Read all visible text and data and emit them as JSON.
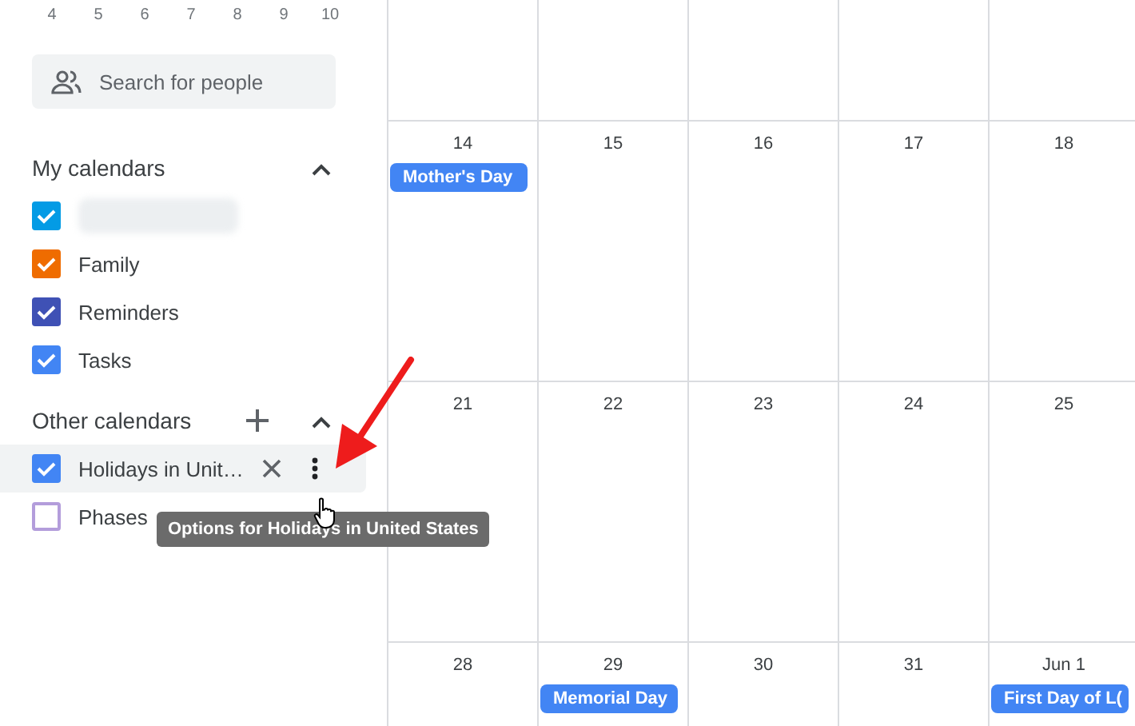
{
  "mini_calendar": {
    "days": [
      "4",
      "5",
      "6",
      "7",
      "8",
      "9",
      "10"
    ]
  },
  "search": {
    "placeholder": "Search for people"
  },
  "my_calendars": {
    "title": "My calendars",
    "expanded": true,
    "items": [
      {
        "kind": "redacted",
        "checked": true,
        "color": "#039be5"
      },
      {
        "kind": "calendar",
        "label": "Family",
        "checked": true,
        "color": "#ef6c00"
      },
      {
        "kind": "calendar",
        "label": "Reminders",
        "checked": true,
        "color": "#3f51b5"
      },
      {
        "kind": "calendar",
        "label": "Tasks",
        "checked": true,
        "color": "#4285f4"
      }
    ]
  },
  "other_calendars": {
    "title": "Other calendars",
    "expanded": true,
    "items": [
      {
        "label": "Holidays in Unit…",
        "checked": true,
        "color": "#4285f4",
        "hovered": true
      },
      {
        "label": "Phases",
        "checked": false,
        "color": "#b39ddb",
        "hovered": false
      }
    ]
  },
  "tooltip": "Options for Holidays in United States",
  "weeks": [
    {
      "days": [
        {
          "date": "14",
          "events": [
            "Mother's Day"
          ]
        },
        {
          "date": "15"
        },
        {
          "date": "16"
        },
        {
          "date": "17"
        },
        {
          "date": "18"
        }
      ]
    },
    {
      "days": [
        {
          "date": "21"
        },
        {
          "date": "22"
        },
        {
          "date": "23"
        },
        {
          "date": "24"
        },
        {
          "date": "25"
        }
      ]
    },
    {
      "days": [
        {
          "date": "28"
        },
        {
          "date": "29",
          "events": [
            "Memorial Day"
          ]
        },
        {
          "date": "30"
        },
        {
          "date": "31"
        },
        {
          "date": "Jun 1",
          "events": [
            "First Day of L("
          ]
        }
      ]
    }
  ]
}
